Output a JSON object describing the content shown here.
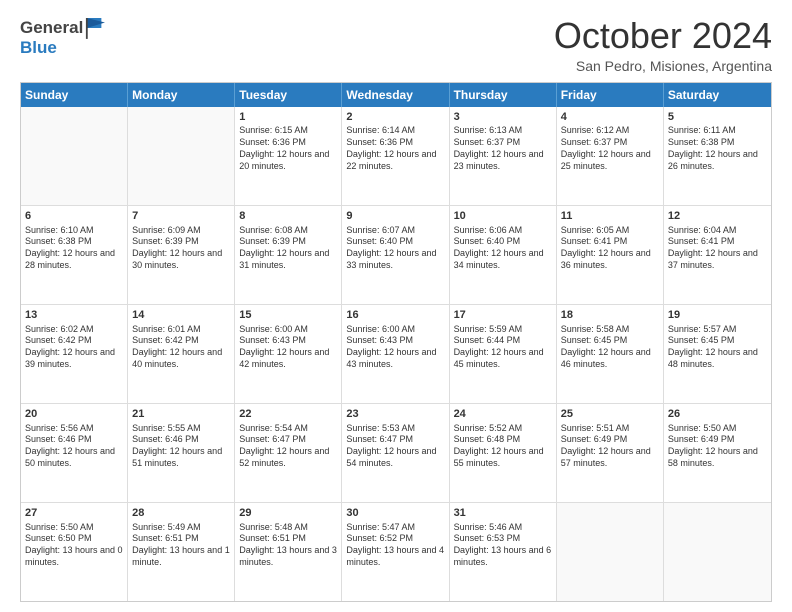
{
  "header": {
    "logo_line1": "General",
    "logo_line2": "Blue",
    "month": "October 2024",
    "location": "San Pedro, Misiones, Argentina"
  },
  "calendar": {
    "weekdays": [
      "Sunday",
      "Monday",
      "Tuesday",
      "Wednesday",
      "Thursday",
      "Friday",
      "Saturday"
    ],
    "rows": [
      [
        {
          "day": "",
          "sunrise": "",
          "sunset": "",
          "daylight": "",
          "empty": true
        },
        {
          "day": "",
          "sunrise": "",
          "sunset": "",
          "daylight": "",
          "empty": true
        },
        {
          "day": "1",
          "sunrise": "Sunrise: 6:15 AM",
          "sunset": "Sunset: 6:36 PM",
          "daylight": "Daylight: 12 hours and 20 minutes."
        },
        {
          "day": "2",
          "sunrise": "Sunrise: 6:14 AM",
          "sunset": "Sunset: 6:36 PM",
          "daylight": "Daylight: 12 hours and 22 minutes."
        },
        {
          "day": "3",
          "sunrise": "Sunrise: 6:13 AM",
          "sunset": "Sunset: 6:37 PM",
          "daylight": "Daylight: 12 hours and 23 minutes."
        },
        {
          "day": "4",
          "sunrise": "Sunrise: 6:12 AM",
          "sunset": "Sunset: 6:37 PM",
          "daylight": "Daylight: 12 hours and 25 minutes."
        },
        {
          "day": "5",
          "sunrise": "Sunrise: 6:11 AM",
          "sunset": "Sunset: 6:38 PM",
          "daylight": "Daylight: 12 hours and 26 minutes."
        }
      ],
      [
        {
          "day": "6",
          "sunrise": "Sunrise: 6:10 AM",
          "sunset": "Sunset: 6:38 PM",
          "daylight": "Daylight: 12 hours and 28 minutes."
        },
        {
          "day": "7",
          "sunrise": "Sunrise: 6:09 AM",
          "sunset": "Sunset: 6:39 PM",
          "daylight": "Daylight: 12 hours and 30 minutes."
        },
        {
          "day": "8",
          "sunrise": "Sunrise: 6:08 AM",
          "sunset": "Sunset: 6:39 PM",
          "daylight": "Daylight: 12 hours and 31 minutes."
        },
        {
          "day": "9",
          "sunrise": "Sunrise: 6:07 AM",
          "sunset": "Sunset: 6:40 PM",
          "daylight": "Daylight: 12 hours and 33 minutes."
        },
        {
          "day": "10",
          "sunrise": "Sunrise: 6:06 AM",
          "sunset": "Sunset: 6:40 PM",
          "daylight": "Daylight: 12 hours and 34 minutes."
        },
        {
          "day": "11",
          "sunrise": "Sunrise: 6:05 AM",
          "sunset": "Sunset: 6:41 PM",
          "daylight": "Daylight: 12 hours and 36 minutes."
        },
        {
          "day": "12",
          "sunrise": "Sunrise: 6:04 AM",
          "sunset": "Sunset: 6:41 PM",
          "daylight": "Daylight: 12 hours and 37 minutes."
        }
      ],
      [
        {
          "day": "13",
          "sunrise": "Sunrise: 6:02 AM",
          "sunset": "Sunset: 6:42 PM",
          "daylight": "Daylight: 12 hours and 39 minutes."
        },
        {
          "day": "14",
          "sunrise": "Sunrise: 6:01 AM",
          "sunset": "Sunset: 6:42 PM",
          "daylight": "Daylight: 12 hours and 40 minutes."
        },
        {
          "day": "15",
          "sunrise": "Sunrise: 6:00 AM",
          "sunset": "Sunset: 6:43 PM",
          "daylight": "Daylight: 12 hours and 42 minutes."
        },
        {
          "day": "16",
          "sunrise": "Sunrise: 6:00 AM",
          "sunset": "Sunset: 6:43 PM",
          "daylight": "Daylight: 12 hours and 43 minutes."
        },
        {
          "day": "17",
          "sunrise": "Sunrise: 5:59 AM",
          "sunset": "Sunset: 6:44 PM",
          "daylight": "Daylight: 12 hours and 45 minutes."
        },
        {
          "day": "18",
          "sunrise": "Sunrise: 5:58 AM",
          "sunset": "Sunset: 6:45 PM",
          "daylight": "Daylight: 12 hours and 46 minutes."
        },
        {
          "day": "19",
          "sunrise": "Sunrise: 5:57 AM",
          "sunset": "Sunset: 6:45 PM",
          "daylight": "Daylight: 12 hours and 48 minutes."
        }
      ],
      [
        {
          "day": "20",
          "sunrise": "Sunrise: 5:56 AM",
          "sunset": "Sunset: 6:46 PM",
          "daylight": "Daylight: 12 hours and 50 minutes."
        },
        {
          "day": "21",
          "sunrise": "Sunrise: 5:55 AM",
          "sunset": "Sunset: 6:46 PM",
          "daylight": "Daylight: 12 hours and 51 minutes."
        },
        {
          "day": "22",
          "sunrise": "Sunrise: 5:54 AM",
          "sunset": "Sunset: 6:47 PM",
          "daylight": "Daylight: 12 hours and 52 minutes."
        },
        {
          "day": "23",
          "sunrise": "Sunrise: 5:53 AM",
          "sunset": "Sunset: 6:47 PM",
          "daylight": "Daylight: 12 hours and 54 minutes."
        },
        {
          "day": "24",
          "sunrise": "Sunrise: 5:52 AM",
          "sunset": "Sunset: 6:48 PM",
          "daylight": "Daylight: 12 hours and 55 minutes."
        },
        {
          "day": "25",
          "sunrise": "Sunrise: 5:51 AM",
          "sunset": "Sunset: 6:49 PM",
          "daylight": "Daylight: 12 hours and 57 minutes."
        },
        {
          "day": "26",
          "sunrise": "Sunrise: 5:50 AM",
          "sunset": "Sunset: 6:49 PM",
          "daylight": "Daylight: 12 hours and 58 minutes."
        }
      ],
      [
        {
          "day": "27",
          "sunrise": "Sunrise: 5:50 AM",
          "sunset": "Sunset: 6:50 PM",
          "daylight": "Daylight: 13 hours and 0 minutes."
        },
        {
          "day": "28",
          "sunrise": "Sunrise: 5:49 AM",
          "sunset": "Sunset: 6:51 PM",
          "daylight": "Daylight: 13 hours and 1 minute."
        },
        {
          "day": "29",
          "sunrise": "Sunrise: 5:48 AM",
          "sunset": "Sunset: 6:51 PM",
          "daylight": "Daylight: 13 hours and 3 minutes."
        },
        {
          "day": "30",
          "sunrise": "Sunrise: 5:47 AM",
          "sunset": "Sunset: 6:52 PM",
          "daylight": "Daylight: 13 hours and 4 minutes."
        },
        {
          "day": "31",
          "sunrise": "Sunrise: 5:46 AM",
          "sunset": "Sunset: 6:53 PM",
          "daylight": "Daylight: 13 hours and 6 minutes."
        },
        {
          "day": "",
          "sunrise": "",
          "sunset": "",
          "daylight": "",
          "empty": true
        },
        {
          "day": "",
          "sunrise": "",
          "sunset": "",
          "daylight": "",
          "empty": true
        }
      ]
    ]
  }
}
